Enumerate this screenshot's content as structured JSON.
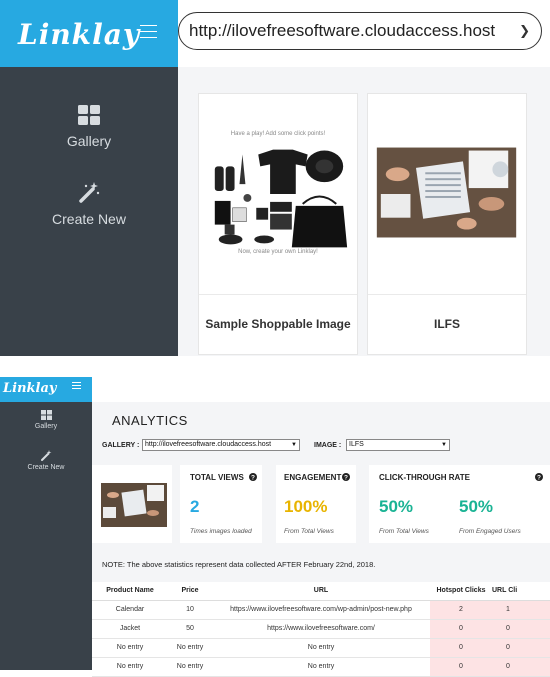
{
  "top": {
    "logo": "Linklay",
    "nav": [
      {
        "label": "Gallery",
        "icon": "grid-icon"
      },
      {
        "label": "Create New",
        "icon": "magic-wand-icon"
      }
    ],
    "url_selected": "http://ilovefreesoftware.cloudaccess.host",
    "cards": [
      {
        "title": "Sample Shoppable Image",
        "caption_top": "Have a play! Add some click points!",
        "caption_bottom": "Now, create your own Linklay!"
      },
      {
        "title": "ILFS"
      }
    ]
  },
  "bottom": {
    "logo": "Linklay",
    "nav": [
      {
        "label": "Gallery",
        "icon": "grid-icon"
      },
      {
        "label": "Create New",
        "icon": "magic-wand-icon"
      }
    ],
    "title": "ANALYTICS",
    "gallery_label": "GALLERY :",
    "gallery_value": "http://ilovefreesoftware.cloudaccess.host",
    "image_label": "IMAGE :",
    "image_value": "ILFS",
    "stats": {
      "total_views": {
        "label": "TOTAL VIEWS",
        "value": "2",
        "sub": "Times images loaded"
      },
      "engagement": {
        "label": "ENGAGEMENT",
        "value": "100%",
        "sub": "From Total Views"
      },
      "ctr": {
        "label": "CLICK-THROUGH RATE",
        "value_a": "50%",
        "sub_a": "From Total Views",
        "value_b": "50%",
        "sub_b": "From Engaged Users"
      }
    },
    "note": "NOTE: The above statistics represent data collected AFTER February 22nd, 2018.",
    "table": {
      "headers": [
        "Product Name",
        "Price",
        "URL",
        "Hotspot Clicks",
        "URL Cli"
      ],
      "rows": [
        [
          "Calendar",
          "10",
          "https://www.ilovefreesoftware.com/wp-admin/post-new.php",
          "2",
          "1"
        ],
        [
          "Jacket",
          "50",
          "https://www.ilovefreesoftware.com/",
          "0",
          "0"
        ],
        [
          "No entry",
          "No entry",
          "No entry",
          "0",
          "0"
        ],
        [
          "No entry",
          "No entry",
          "No entry",
          "0",
          "0"
        ]
      ]
    },
    "colors": {
      "accent": "#27a9e1",
      "sidebar": "#394149",
      "views": "#27a9e1",
      "engagement": "#e8b400",
      "ctr": "#1ab394"
    }
  }
}
